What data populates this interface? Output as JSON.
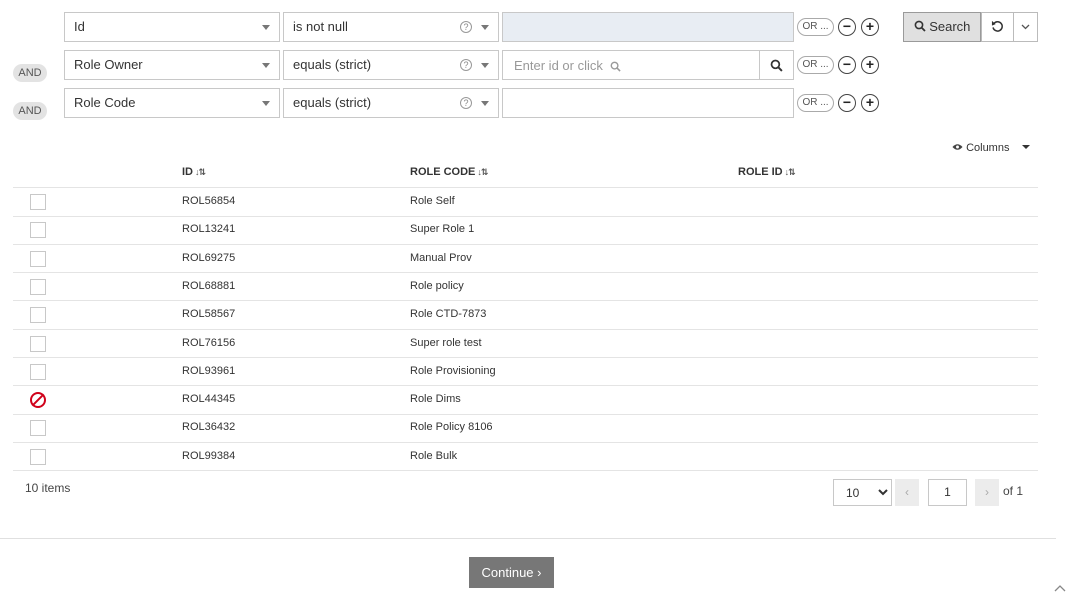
{
  "filters": [
    {
      "join": "",
      "field": "Id",
      "operator": "is not null",
      "value": "",
      "placeholder": "",
      "or_label": "OR ..."
    },
    {
      "join": "AND",
      "field": "Role Owner",
      "operator": "equals (strict)",
      "value": "",
      "placeholder": "Enter id or click",
      "or_label": "OR ..."
    },
    {
      "join": "AND",
      "field": "Role Code",
      "operator": "equals (strict)",
      "value": "",
      "placeholder": "",
      "or_label": "OR ..."
    }
  ],
  "toolbar": {
    "search_label": "Search",
    "columns_label": "Columns"
  },
  "table": {
    "headers": [
      "ID",
      "ROLE CODE",
      "ROLE ID"
    ],
    "rows": [
      {
        "id": "ROL56854",
        "role_code": "Role Self",
        "blocked": false
      },
      {
        "id": "ROL13241",
        "role_code": "Super Role 1",
        "blocked": false
      },
      {
        "id": "ROL69275",
        "role_code": "Manual Prov",
        "blocked": false
      },
      {
        "id": "ROL68881",
        "role_code": "Role policy",
        "blocked": false
      },
      {
        "id": "ROL58567",
        "role_code": "Role CTD-7873",
        "blocked": false
      },
      {
        "id": "ROL76156",
        "role_code": "Super role test",
        "blocked": false
      },
      {
        "id": "ROL93961",
        "role_code": "Role Provisioning",
        "blocked": false
      },
      {
        "id": "ROL44345",
        "role_code": "Role Dims",
        "blocked": true
      },
      {
        "id": "ROL36432",
        "role_code": "Role Policy 8106",
        "blocked": false
      },
      {
        "id": "ROL99384",
        "role_code": "Role Bulk",
        "blocked": false
      }
    ]
  },
  "footer": {
    "items_count": "10 items",
    "page_size": "10",
    "page_size_options": [
      "10"
    ],
    "current_page": "1",
    "of_pages": "of 1"
  },
  "continue_label": "Continue ›",
  "colors": {
    "blocked": "#d0021b",
    "filled_input": "#e8edf3",
    "continue_bg": "#777777"
  }
}
